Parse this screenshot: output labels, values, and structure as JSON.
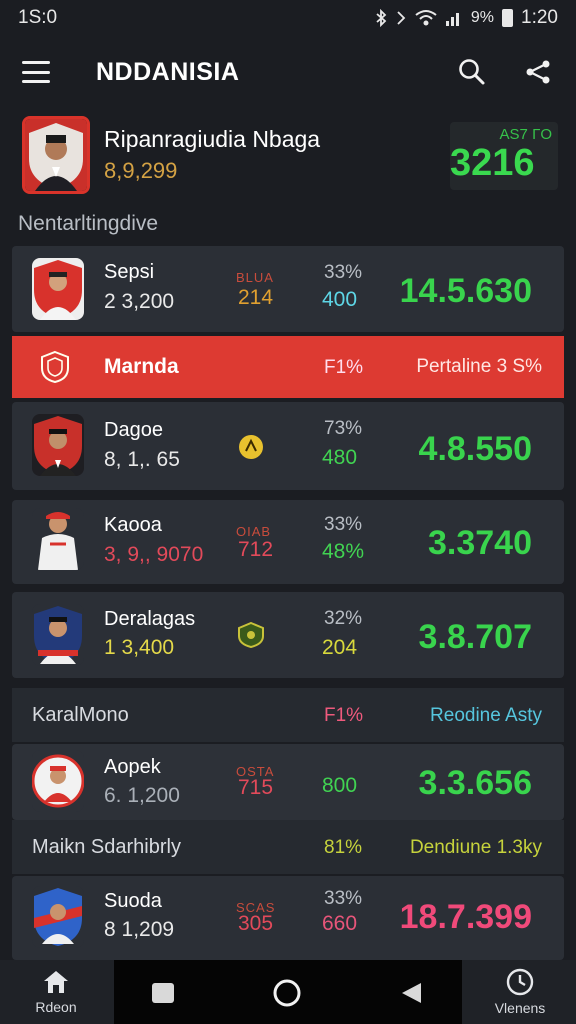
{
  "status_bar": {
    "left": "1S:0",
    "signal": "9%",
    "time": "1:20"
  },
  "app_bar": {
    "title": "NDDANISIA"
  },
  "featured": {
    "name": "Ripanragiudia Nbaga",
    "sub": "8,9,299",
    "score_label": "AS7 ΓO",
    "score": "3216"
  },
  "section_label": "Nentarltingdive",
  "rows": [
    {
      "name": "Sepsi",
      "count": "2 3,200",
      "mini": "BLUA",
      "code": "214",
      "pct": "33%",
      "score": "400",
      "big": "14.5.630",
      "code_color": "#e0a030",
      "score_color": "#5ed6e6",
      "big_color": "#39d44d"
    },
    {
      "name": "Dagoe",
      "count": "8, 1,. 65",
      "pct": "73%",
      "score": "480",
      "big": "4.8.550",
      "score_color": "#41d352",
      "big_color": "#39d44d"
    },
    {
      "name": "Kaooa",
      "count": "3, 9,, 9070",
      "mini": "OIAB",
      "code": "712",
      "pct": "33%",
      "score": "48%",
      "big": "3.3740",
      "code_color": "#e24a5a",
      "score_color": "#41d352",
      "big_color": "#39d44d"
    },
    {
      "name": "Deralagas",
      "count": "1 3,400",
      "pct": "32%",
      "score": "204",
      "big": "3.8.707",
      "score_color": "#d8d93c",
      "big_color": "#39d44d"
    },
    {
      "name": "Aopek",
      "count": "6. 1,200",
      "mini": "OSTA",
      "code": "715",
      "score": "800",
      "big": "3.3.656",
      "code_color": "#e24a5a",
      "score_color": "#41d352",
      "big_color": "#39d44d"
    },
    {
      "name": "Suoda",
      "count": "8 1,209",
      "mini": "SCAS",
      "code": "305",
      "pct": "33%",
      "score": "660",
      "big": "18.7.399",
      "code_color": "#e24a5a",
      "score_color": "#e8557a",
      "big_color": "#f04a7a"
    }
  ],
  "banner": {
    "name": "Marnda",
    "pct": "F1%",
    "right": "Pertaline 3 S%"
  },
  "subheads": [
    {
      "left": "KaralMono",
      "pct": "F1%",
      "right": "Reodine Asty",
      "pct_color": "#ef5a7d",
      "right_color": "#56c6de"
    },
    {
      "left": "Maikn Sdarhibrly",
      "pct": "81%",
      "right": "Dendiune 1.3ky",
      "pct_color": "#c6d33c",
      "right_color": "#c6d33c"
    }
  ],
  "bottom_nav": {
    "home": "Rdeon",
    "views": "Vlenens"
  },
  "colors": {
    "accent_red": "#dd3a32",
    "accent_green": "#39d44d",
    "bg": "#1b1d22",
    "row_bg": "#2b2f36"
  }
}
